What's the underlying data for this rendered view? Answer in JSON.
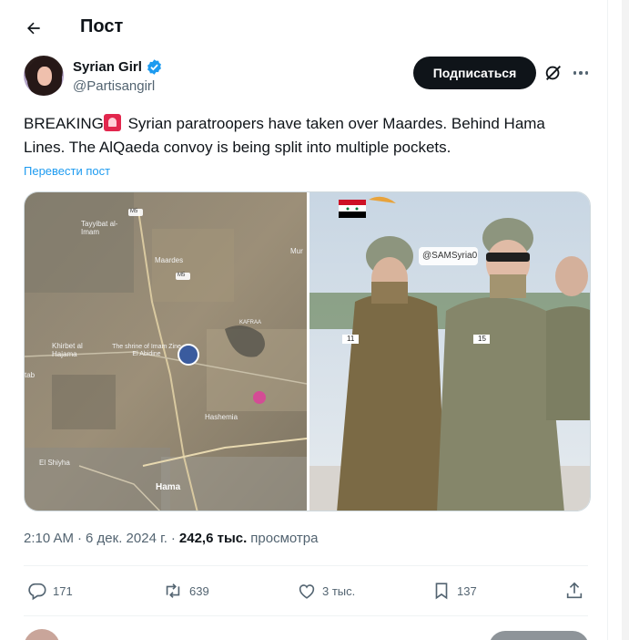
{
  "header": {
    "title": "Пост",
    "back_icon": "arrow-left-icon"
  },
  "author": {
    "name": "Syrian Girl",
    "handle": "@Partisangirl",
    "verified": true,
    "verified_color": "#1d9bf0"
  },
  "actions_top": {
    "subscribe_label": "Подписаться"
  },
  "post": {
    "text_before": "BREAKING",
    "text_after": " Syrian paratroopers have taken over Maardes. Behind Hama Lines. The AlQaeda convoy is being split into multiple pockets.",
    "emoji_icon": "police-siren-icon",
    "translate_label": "Перевести пост"
  },
  "media": {
    "map_labels": {
      "tayyibat": "Tayyibat al-Imam",
      "maardes": "Maardes",
      "shrine": "The shrine of Imam Zine El Abidine",
      "khirbet": "Khirbet al Hajama",
      "hashemia": "Hashemia",
      "shiyha": "El Shiyha",
      "hama": "Hama",
      "kafraa": "KAFRAA",
      "tab": "tab",
      "mur": "Mur",
      "m5a": "M5",
      "m5b": "M5"
    },
    "photo_watermark": "@SAMSyria0",
    "patch_left": "11",
    "patch_right": "15"
  },
  "meta": {
    "time": "2:10 AM",
    "sep1": "·",
    "date": "6 дек. 2024 г.",
    "sep2": "·",
    "views": "242,6 тыс.",
    "views_label": "просмотра"
  },
  "stats": {
    "replies": "171",
    "reposts": "639",
    "likes": "3 тыс.",
    "bookmarks": "137"
  },
  "colors": {
    "accent": "#1d9bf0",
    "text": "#0f1419",
    "muted": "#536471"
  }
}
